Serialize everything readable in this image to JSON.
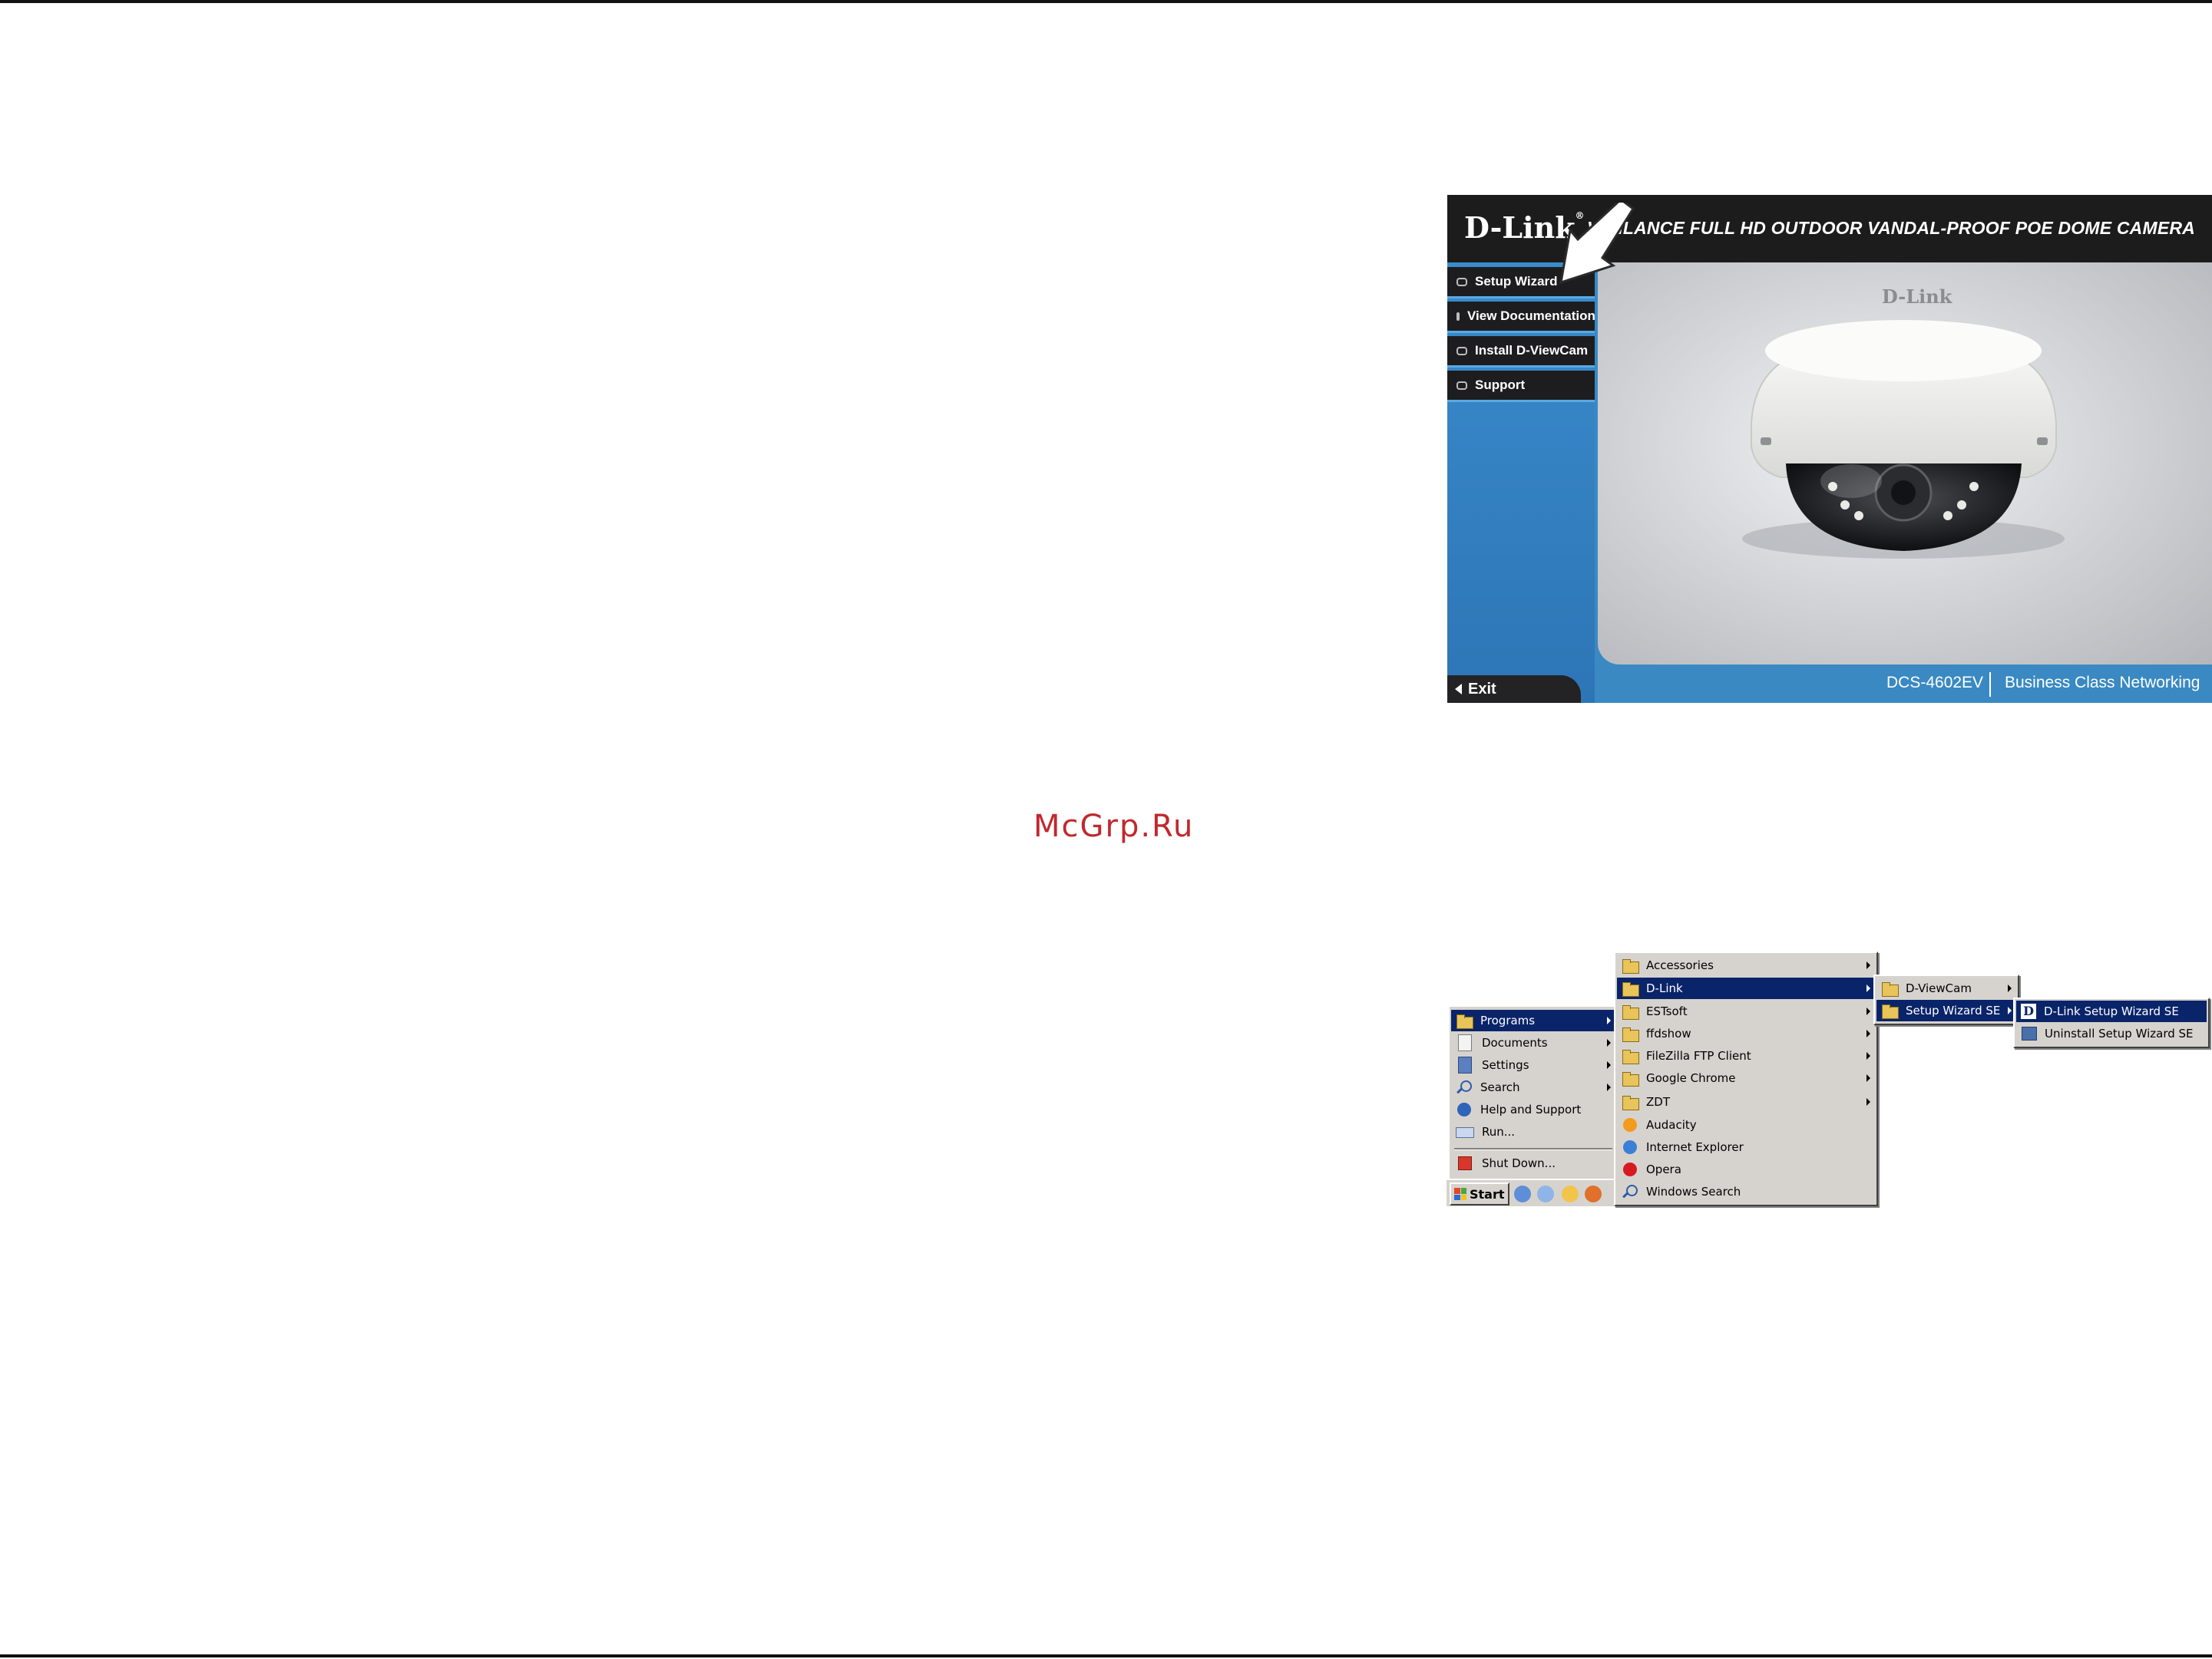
{
  "watermark": "McGrp.Ru",
  "autorun": {
    "logo": "D-Link",
    "logo_reg": "®",
    "headline": "VIGILANCE FULL HD OUTDOOR VANDAL-PROOF POE DOME CAMERA",
    "menu": [
      {
        "label": "Setup Wizard"
      },
      {
        "label": "View Documentation"
      },
      {
        "label": "Install D-ViewCam"
      },
      {
        "label": "Support"
      }
    ],
    "camera_brand": "D-Link",
    "exit_label": "Exit",
    "model": "DCS-4602EV",
    "tagline": "Business Class Networking",
    "colors": {
      "sidebar_blue": "#3a89c2",
      "dark": "#1c1c1c"
    }
  },
  "start_menu": {
    "start_label": "Start",
    "main_items": [
      {
        "label": "Programs",
        "icon": "programs-icon",
        "submenu": true,
        "selected": true
      },
      {
        "label": "Documents",
        "icon": "documents-icon",
        "submenu": true
      },
      {
        "label": "Settings",
        "icon": "settings-icon",
        "submenu": true
      },
      {
        "label": "Search",
        "icon": "search-icon",
        "submenu": true
      },
      {
        "label": "Help and Support",
        "icon": "help-icon"
      },
      {
        "label": "Run...",
        "icon": "run-icon"
      },
      {
        "label": "Shut Down...",
        "icon": "shutdown-icon"
      }
    ],
    "programs": [
      {
        "label": "Accessories",
        "submenu": true
      },
      {
        "label": "D-Link",
        "submenu": true,
        "selected": true
      },
      {
        "label": "ESTsoft",
        "submenu": true
      },
      {
        "label": "ffdshow",
        "submenu": true
      },
      {
        "label": "FileZilla FTP Client",
        "submenu": true
      },
      {
        "label": "Google Chrome",
        "submenu": true
      },
      {
        "label": "ZDT",
        "submenu": true
      },
      {
        "label": "Audacity"
      },
      {
        "label": "Internet Explorer"
      },
      {
        "label": "Opera"
      },
      {
        "label": "Windows Search"
      }
    ],
    "dlink_items": [
      {
        "label": "D-ViewCam",
        "submenu": true
      },
      {
        "label": "Setup Wizard SE",
        "submenu": true,
        "selected": true
      }
    ],
    "wizard_items": [
      {
        "label": "D-Link Setup Wizard SE",
        "selected": true
      },
      {
        "label": "Uninstall Setup Wizard SE"
      }
    ]
  }
}
